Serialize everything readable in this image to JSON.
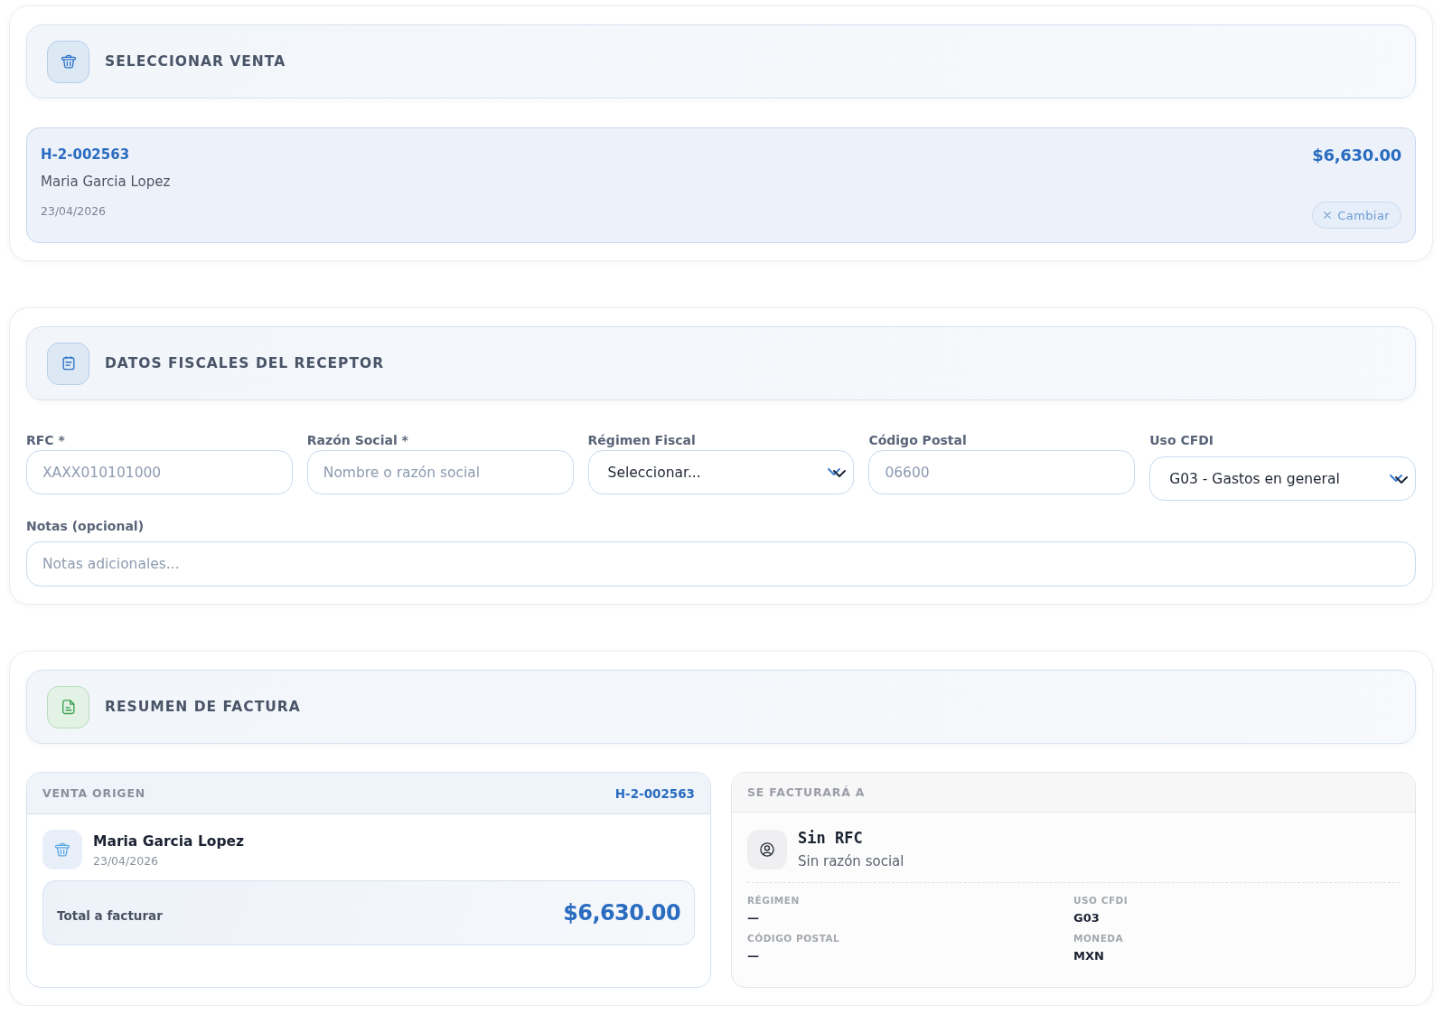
{
  "sections": [
    {
      "kind": "sale_picker",
      "title": "SELECCIONAR VENTA",
      "sale": {
        "folio": "H-2-002563",
        "customer": "Maria Garcia Lopez",
        "date": "23/04/2026",
        "total": "$6,630.00",
        "change_button": "Cambiar"
      }
    },
    {
      "kind": "receiver",
      "title": "DATOS FISCALES DEL RECEPTOR",
      "fields": [
        {
          "kind": "text",
          "label": "RFC *",
          "placeholder": "XAXX010101000"
        },
        {
          "kind": "text",
          "label": "Razón Social *",
          "placeholder": "Nombre o razón social"
        },
        {
          "kind": "select",
          "label": "Régimen Fiscal",
          "value": "Seleccionar..."
        },
        {
          "kind": "text",
          "label": "Código Postal",
          "placeholder": "06600"
        },
        {
          "kind": "select",
          "label": "Uso CFDI",
          "value": "G03 - Gastos en general"
        }
      ],
      "notes": {
        "label": "Notas (opcional)",
        "placeholder": "Notas adicionales..."
      }
    },
    {
      "kind": "summary",
      "title": "RESUMEN DE FACTURA",
      "origin": {
        "heading": "VENTA ORIGEN",
        "folio": "H-2-002563",
        "customer": "Maria Garcia Lopez",
        "date": "23/04/2026",
        "total_label": "Total a facturar",
        "total": "$6,630.00"
      },
      "bill_to": {
        "heading": "SE FACTURARÁ A",
        "rfc": "Sin RFC",
        "business_name": "Sin razón social",
        "details": [
          {
            "label": "RÉGIMEN",
            "value": "—"
          },
          {
            "label": "USO CFDI",
            "value": "G03"
          },
          {
            "label": "CÓDIGO POSTAL",
            "value": "—"
          },
          {
            "label": "MONEDA",
            "value": "MXN"
          }
        ]
      }
    }
  ]
}
